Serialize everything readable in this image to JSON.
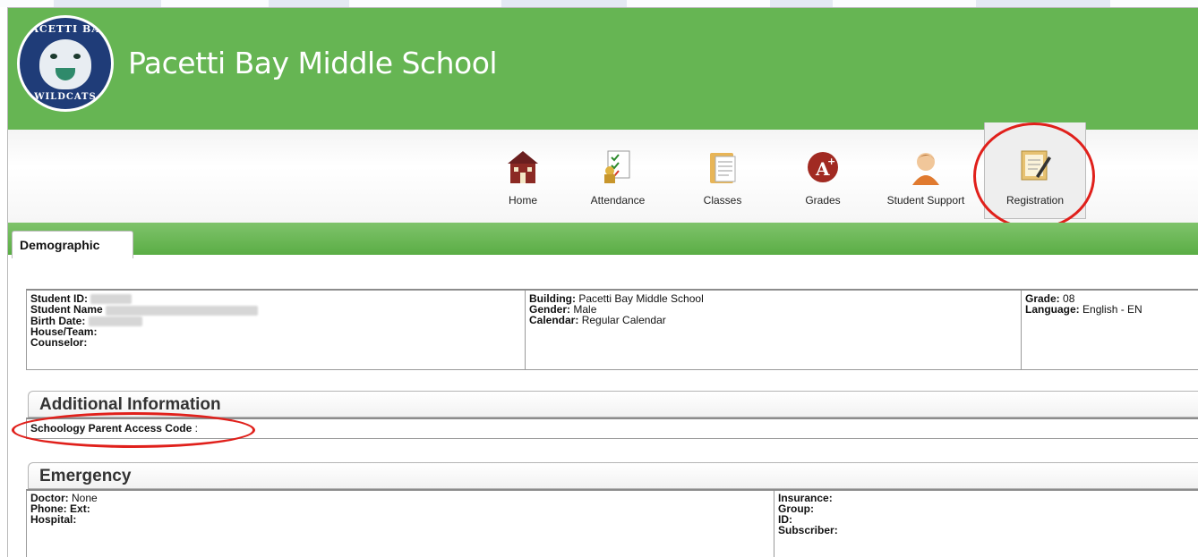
{
  "header": {
    "school_name": "Pacetti Bay Middle School",
    "logo_top": "PACETTI BAY",
    "logo_bottom": "WILDCATS"
  },
  "nav": {
    "items": [
      {
        "label": "Home",
        "icon": "house-icon"
      },
      {
        "label": "Attendance",
        "icon": "attendance-icon"
      },
      {
        "label": "Classes",
        "icon": "classes-icon"
      },
      {
        "label": "Grades",
        "icon": "grades-icon"
      },
      {
        "label": "Student Support",
        "icon": "student-support-icon"
      },
      {
        "label": "Registration",
        "icon": "registration-icon"
      }
    ],
    "active": "Registration"
  },
  "tabs": {
    "demographic": "Demographic"
  },
  "demographic": {
    "student_id_label": "Student ID:",
    "student_name_label": "Student Name",
    "birth_date_label": "Birth Date:",
    "house_team_label": "House/Team:",
    "counselor_label": "Counselor:",
    "building_label": "Building:",
    "building_value": "Pacetti Bay Middle School",
    "gender_label": "Gender:",
    "gender_value": "Male",
    "calendar_label": "Calendar:",
    "calendar_value": "Regular Calendar",
    "grade_label": "Grade:",
    "grade_value": "08",
    "language_label": "Language:",
    "language_value": "English - EN"
  },
  "additional": {
    "title": "Additional Information",
    "schoology_label": "Schoology Parent Access Code",
    "schoology_colon": ":"
  },
  "emergency": {
    "title": "Emergency",
    "doctor_label": "Doctor:",
    "doctor_value": "None",
    "phone_label": "Phone:",
    "ext_label": "Ext:",
    "hospital_label": "Hospital:",
    "insurance_label": "Insurance:",
    "group_label": "Group:",
    "id_label": "ID:",
    "subscriber_label": "Subscriber:"
  },
  "colors": {
    "header_green": "#66b553",
    "annotation_red": "#e0201b",
    "logo_navy": "#1f3c78"
  }
}
